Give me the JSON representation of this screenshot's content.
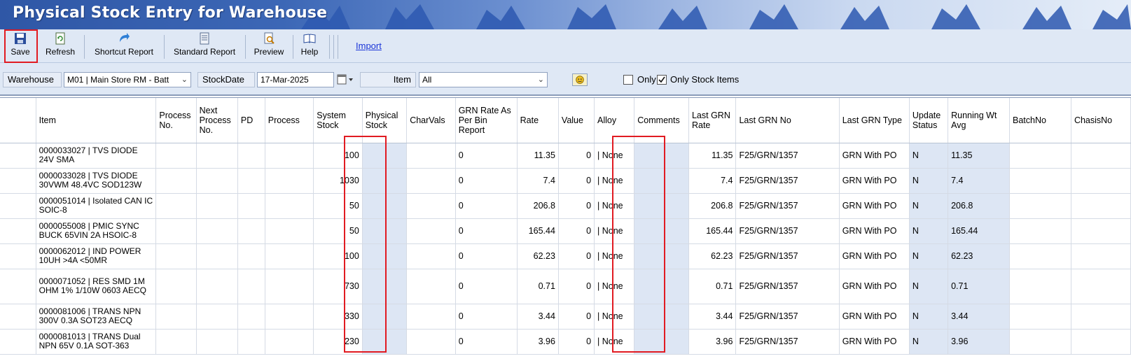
{
  "title": "Physical Stock Entry for Warehouse",
  "toolbar": {
    "save": "Save",
    "refresh": "Refresh",
    "shortcut_report": "Shortcut Report",
    "standard_report": "Standard Report",
    "preview": "Preview",
    "help": "Help",
    "import": "Import"
  },
  "filters": {
    "warehouse_label": "Warehouse",
    "warehouse_value": "M01 | Main Store RM - Batt",
    "stockdate_label": "StockDate",
    "stockdate_value": "17-Mar-2025",
    "item_label": "Item",
    "item_value": "All",
    "only_label": "Only",
    "only_checked": false,
    "only_stock_items_label": "Only Stock Items",
    "only_stock_items_checked": true
  },
  "columns": [
    "Item",
    "Process No.",
    "Next Process No.",
    "PD",
    "Process",
    "System Stock",
    "Physical Stock",
    "CharVals",
    "GRN Rate As Per Bin Report",
    "Rate",
    "Value",
    "Alloy",
    "Comments",
    "Last GRN Rate",
    "Last GRN No",
    "Last GRN Type",
    "Update Status",
    "Running Wt Avg",
    "BatchNo",
    "ChasisNo"
  ],
  "rows": [
    {
      "item": "0000033027 | TVS DIODE 24V SMA",
      "system_stock": "100",
      "grn_rate_bin": "0",
      "rate": "11.35",
      "value": "0",
      "alloy": "| None",
      "last_grn_rate": "11.35",
      "last_grn_no": "F25/GRN/1357",
      "last_grn_type": "GRN With PO",
      "update_status": "N",
      "running_wt_avg": "11.35"
    },
    {
      "item": "0000033028 | TVS DIODE 30VWM 48.4VC SOD123W",
      "system_stock": "1030",
      "grn_rate_bin": "0",
      "rate": "7.4",
      "value": "0",
      "alloy": "| None",
      "last_grn_rate": "7.4",
      "last_grn_no": "F25/GRN/1357",
      "last_grn_type": "GRN With PO",
      "update_status": "N",
      "running_wt_avg": "7.4"
    },
    {
      "item": "0000051014 | Isolated CAN IC SOIC-8",
      "system_stock": "50",
      "grn_rate_bin": "0",
      "rate": "206.8",
      "value": "0",
      "alloy": "| None",
      "last_grn_rate": "206.8",
      "last_grn_no": "F25/GRN/1357",
      "last_grn_type": "GRN With PO",
      "update_status": "N",
      "running_wt_avg": "206.8"
    },
    {
      "item": "0000055008 | PMIC SYNC BUCK 65VIN 2A HSOIC-8",
      "system_stock": "50",
      "grn_rate_bin": "0",
      "rate": "165.44",
      "value": "0",
      "alloy": "| None",
      "last_grn_rate": "165.44",
      "last_grn_no": "F25/GRN/1357",
      "last_grn_type": "GRN With PO",
      "update_status": "N",
      "running_wt_avg": "165.44"
    },
    {
      "item": "0000062012 | IND POWER 10UH >4A <50MR",
      "system_stock": "100",
      "grn_rate_bin": "0",
      "rate": "62.23",
      "value": "0",
      "alloy": "| None",
      "last_grn_rate": "62.23",
      "last_grn_no": "F25/GRN/1357",
      "last_grn_type": "GRN With PO",
      "update_status": "N",
      "running_wt_avg": "62.23"
    },
    {
      "item": "0000071052 | RES SMD 1M OHM 1% 1/10W 0603 AECQ",
      "system_stock": "730",
      "grn_rate_bin": "0",
      "rate": "0.71",
      "value": "0",
      "alloy": "| None",
      "last_grn_rate": "0.71",
      "last_grn_no": "F25/GRN/1357",
      "last_grn_type": "GRN With PO",
      "update_status": "N",
      "running_wt_avg": "0.71"
    },
    {
      "item": "0000081006 | TRANS NPN 300V 0.3A SOT23 AECQ",
      "system_stock": "330",
      "grn_rate_bin": "0",
      "rate": "3.44",
      "value": "0",
      "alloy": "| None",
      "last_grn_rate": "3.44",
      "last_grn_no": "F25/GRN/1357",
      "last_grn_type": "GRN With PO",
      "update_status": "N",
      "running_wt_avg": "3.44"
    },
    {
      "item": "0000081013 | TRANS Dual NPN 65V 0.1A SOT-363",
      "system_stock": "230",
      "grn_rate_bin": "0",
      "rate": "3.96",
      "value": "0",
      "alloy": "| None",
      "last_grn_rate": "3.96",
      "last_grn_no": "F25/GRN/1357",
      "last_grn_type": "GRN With PO",
      "update_status": "N",
      "running_wt_avg": "3.96"
    }
  ],
  "colors": {
    "highlight_red": "#e11b22",
    "toolbar_bg": "#dfe8f5",
    "shaded_cell": "#dde6f4",
    "link_blue": "#1a35d8"
  },
  "icons": [
    "save-icon",
    "refresh-icon",
    "shortcut-report-icon",
    "standard-report-icon",
    "preview-icon",
    "help-icon",
    "calendar-icon",
    "smiley-icon",
    "chevron-down-icon"
  ]
}
